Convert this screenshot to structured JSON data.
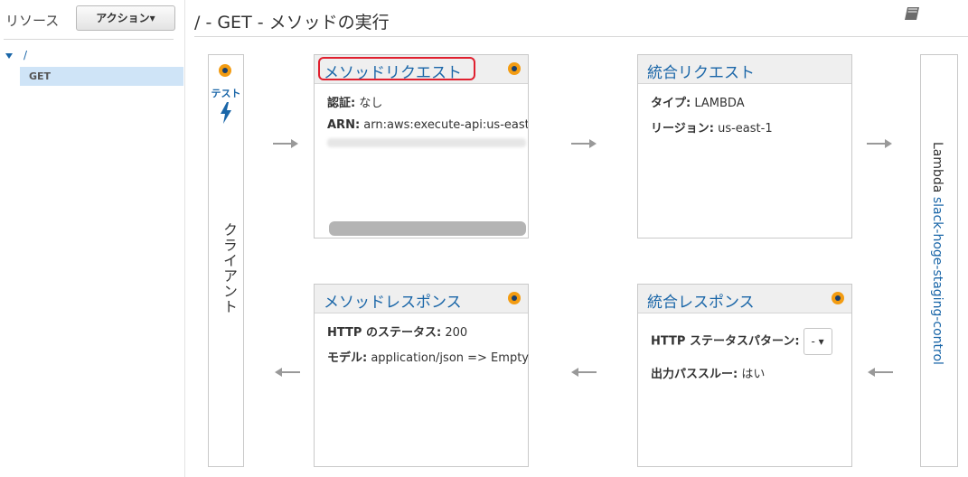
{
  "sidebar": {
    "title": "リソース",
    "actions_label": "アクション▾",
    "tree": {
      "root_label": "/",
      "method_label": "GET"
    }
  },
  "header": {
    "title": "/ - GET - メソッドの実行"
  },
  "client": {
    "test_label": "テスト",
    "label": "クライアント"
  },
  "method_request": {
    "title": "メソッドリクエスト",
    "auth_key": "認証:",
    "auth_value": "なし",
    "arn_key": "ARN:",
    "arn_value": "arn:aws:execute-api:us-east-"
  },
  "integration_request": {
    "title": "統合リクエスト",
    "type_key": "タイプ:",
    "type_value": "LAMBDA",
    "region_key": "リージョン:",
    "region_value": "us-east-1"
  },
  "method_response": {
    "title": "メソッドレスポンス",
    "status_key": "HTTP のステータス:",
    "status_value": "200",
    "model_key": "モデル:",
    "model_value": "application/json => Empty"
  },
  "integration_response": {
    "title": "統合レスポンス",
    "pattern_key": "HTTP ステータスパターン:",
    "pattern_value": "-",
    "passthrough_key": "出力パススルー:",
    "passthrough_value": "はい"
  },
  "lambda": {
    "prefix": "Lambda",
    "function_name": "slack-hoge-staging-control"
  },
  "colors": {
    "accent": "#1a66a8",
    "dot": "#f39c12",
    "highlight": "#e0202f"
  }
}
